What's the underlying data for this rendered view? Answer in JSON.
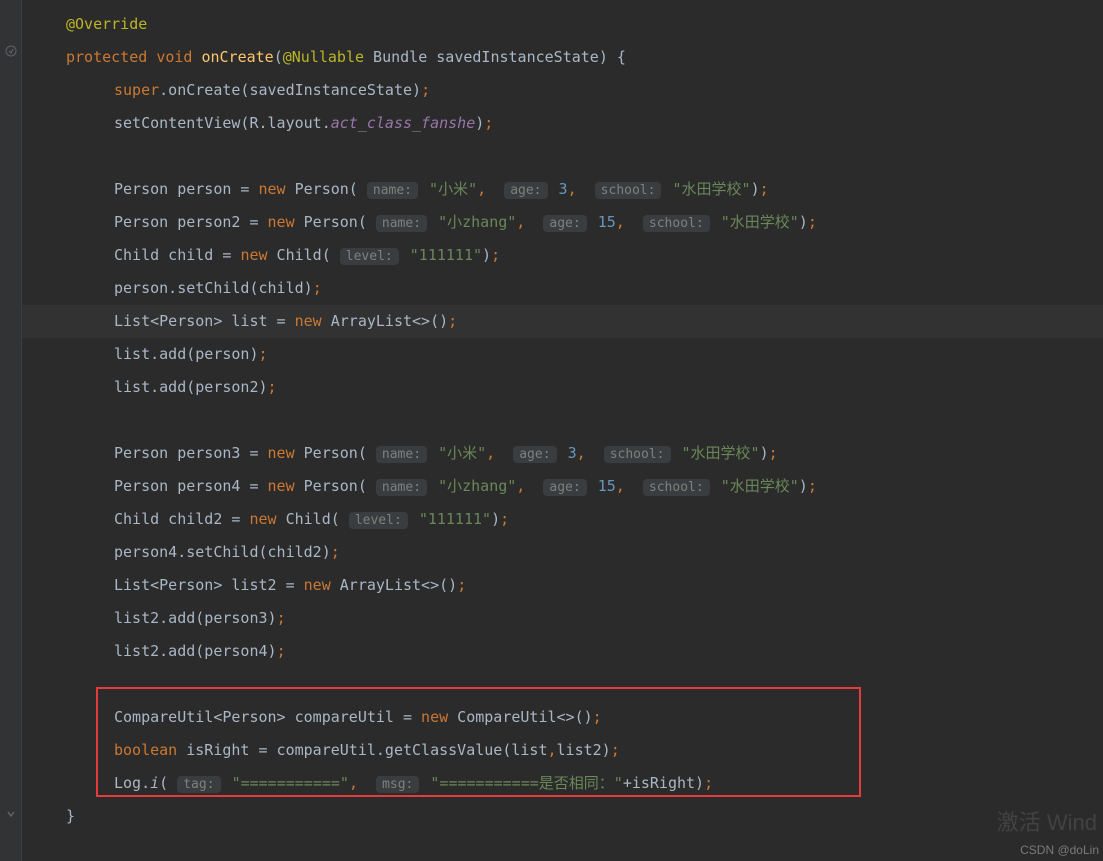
{
  "code": {
    "l1_annotation": "@Override",
    "l2_protected": "protected",
    "l2_void": "void",
    "l2_method": "onCreate",
    "l2_paren_open": "(",
    "l2_nullable": "@Nullable",
    "l2_bundle": " Bundle savedInstanceState) {",
    "l3_super": "super",
    "l3_oncreate": ".onCreate(savedInstanceState)",
    "l4_setcontent": "setContentView(R.layout.",
    "l4_layout": "act_class_fanshe",
    "l4_close": ")",
    "l6_person": "Person person = ",
    "l6_new": "new",
    "l6_person2": " Person(",
    "l6_hint_name": "name:",
    "l6_name_val": "\"小米\"",
    "l6_hint_age": "age:",
    "l6_age_val": "3",
    "l6_hint_school": "school:",
    "l6_school_val": "\"水田学校\"",
    "l6_close": ")",
    "l7_person": "Person person2 = ",
    "l7_new": "new",
    "l7_person2": " Person(",
    "l7_name_val": "\"小zhang\"",
    "l7_age_val": "15",
    "l7_school_val": "\"水田学校\"",
    "l7_close": ")",
    "l8_child": "Child child = ",
    "l8_new": "new",
    "l8_child2": " Child(",
    "l8_hint_level": "level:",
    "l8_level_val": "\"111111\"",
    "l8_close": ")",
    "l9": "person.setChild(child)",
    "l10_list": "List<Person> list = ",
    "l10_new": "new",
    "l10_arraylist": " ArrayList<>()",
    "l11": "list.add(person)",
    "l12": "list.add(person2)",
    "l14_person": "Person person3 = ",
    "l14_new": "new",
    "l14_person2": " Person(",
    "l15_person": "Person person4 = ",
    "l15_new": "new",
    "l15_person2": " Person(",
    "l16_child": "Child child2 = ",
    "l16_new": "new",
    "l16_child2": " Child(",
    "l17": "person4.setChild(child2)",
    "l18_list": "List<Person> list2 = ",
    "l18_new": "new",
    "l18_arraylist": " ArrayList<>()",
    "l19": "list2.add(person3)",
    "l20": "list2.add(person4)",
    "l22_compare": "CompareUtil<Person> compareUtil = ",
    "l22_new": "new",
    "l22_compare2": " CompareUtil<>()",
    "l23_boolean": "boolean",
    "l23_rest": " isRight = compareUtil.getClassValue(list",
    "l23_comma": ",",
    "l23_rest2": "list2)",
    "l24_log": "Log.",
    "l24_i": "i",
    "l24_paren": "(",
    "l24_hint_tag": "tag:",
    "l24_tag_val": "\"===========\"",
    "l24_hint_msg": "msg:",
    "l24_msg_val": "\"===========是否相同：\"",
    "l24_plus": "+isRight)",
    "l25_brace": "}",
    "semi": ";",
    "comma": ", "
  },
  "watermark": "激活 Wind",
  "csdn": "CSDN @doLin"
}
